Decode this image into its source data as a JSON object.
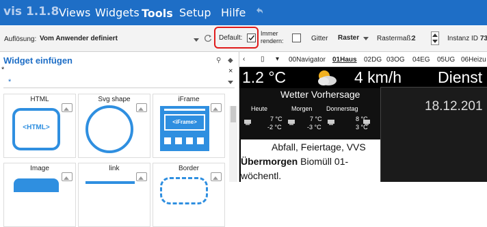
{
  "menubar": {
    "logo": "vis 1.1.8",
    "items": [
      "Views",
      "Widgets",
      "Tools",
      "Setup",
      "Hilfe"
    ],
    "active": "Tools"
  },
  "toolbar": {
    "resolution_label": "Auflösung:",
    "resolution_value": "Vom Anwender definiert",
    "default_label": "Default:",
    "default_checked": true,
    "always_render_label_1": "Immer",
    "always_render_label_2": "rendern:",
    "grid_label": "Gitter",
    "grid_value": "Raster",
    "grid_size_label": "Rastermaß:",
    "grid_size_value": "2",
    "instance_label": "Instanz ID",
    "instance_value": "73"
  },
  "left_panel": {
    "title": "Widget einfügen",
    "star": "*",
    "close": "×",
    "filter_value": "*",
    "tiles": [
      {
        "label": "HTML",
        "preview": "<HTML>"
      },
      {
        "label": "Svg shape"
      },
      {
        "label": "iFrame",
        "preview": "<iFrame>"
      },
      {
        "label": "Image"
      },
      {
        "label": "link"
      },
      {
        "label": "Border"
      }
    ]
  },
  "view_tabs": {
    "items": [
      "00Navigator",
      "01Haus",
      "02DG",
      "03OG",
      "04EG",
      "05UG",
      "06Heizu"
    ],
    "active": "01Haus"
  },
  "view": {
    "temperature": "1.2 °C",
    "wind": "4 km/h",
    "weekday": "Dienst",
    "forecast_title": "Wetter Vorhersage",
    "forecast_days": [
      {
        "day": "Heute",
        "high": "7 °C",
        "low": "-2 °C"
      },
      {
        "day": "Morgen",
        "high": "7 °C",
        "low": "-3 °C"
      },
      {
        "day": "Donnerstag",
        "high": "8 °C",
        "low": "3 °C"
      }
    ],
    "date": "18.12.201",
    "waste_title": "Abfall, Feiertage, VVS",
    "waste_bold": "Übermorgen",
    "waste_text_1": " Biomüll 01-",
    "waste_text_2": "wöchentl."
  }
}
